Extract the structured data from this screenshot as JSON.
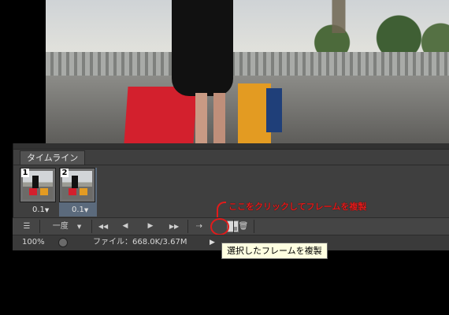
{
  "panel": {
    "tab_label": "タイムライン"
  },
  "frames": [
    {
      "number": "1",
      "delay": "0.1",
      "selected": false
    },
    {
      "number": "2",
      "delay": "0.1",
      "selected": true
    }
  ],
  "toolbar": {
    "loop_label": "一度",
    "loop_arrow": "▼",
    "first_frame": "◀◀",
    "prev_frame": "◀",
    "play": "▶",
    "next_frame": "▶▶"
  },
  "status": {
    "zoom": "100%",
    "file_info": "ファイル：668.0K/3.67M",
    "play_arrow": "▶"
  },
  "annotation": "ここをクリックしてフレームを複製",
  "tooltip": "選択したフレームを複製",
  "colors": {
    "annotation": "#e21b1b",
    "tooltip_bg": "#ffffe1",
    "panel_bg": "#3f3f3f",
    "selected_frame": "#5b6a7c"
  },
  "icons": [
    "tween-icon",
    "new-layer-icon",
    "duplicate-frame-icon",
    "trash-icon",
    "histogram-icon"
  ]
}
